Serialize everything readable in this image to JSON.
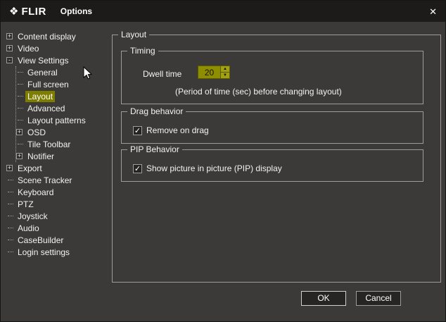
{
  "titlebar": {
    "brand": "FLIR",
    "title": "Options"
  },
  "icons": {
    "logo": "❖",
    "close": "✕",
    "up_arrow": "▲",
    "down_arrow": "▼",
    "check": "✓"
  },
  "tree": {
    "items": [
      {
        "label": "Content display",
        "glyph": "+"
      },
      {
        "label": "Video",
        "glyph": "+"
      },
      {
        "label": "View Settings",
        "glyph": "-"
      },
      {
        "label": "General"
      },
      {
        "label": "Full screen"
      },
      {
        "label": "Layout",
        "selected": true
      },
      {
        "label": "Advanced"
      },
      {
        "label": "Layout patterns"
      },
      {
        "label": "OSD",
        "glyph": "+"
      },
      {
        "label": "Tile Toolbar"
      },
      {
        "label": "Notifier",
        "glyph": "+"
      },
      {
        "label": "Export",
        "glyph": "+"
      },
      {
        "label": "Scene Tracker"
      },
      {
        "label": "Keyboard"
      },
      {
        "label": "PTZ"
      },
      {
        "label": "Joystick"
      },
      {
        "label": "Audio"
      },
      {
        "label": "CaseBuilder"
      },
      {
        "label": "Login settings"
      }
    ]
  },
  "panel": {
    "title": "Layout",
    "timing": {
      "title": "Timing",
      "dwell_label": "Dwell time",
      "dwell_value": "20",
      "hint": "(Period of time (sec) before changing layout)"
    },
    "drag": {
      "title": "Drag behavior",
      "option": "Remove on drag",
      "checked": true
    },
    "pip": {
      "title": "PIP Behavior",
      "option": "Show picture in picture (PIP) display",
      "checked": true
    }
  },
  "buttons": {
    "ok": "OK",
    "cancel": "Cancel"
  },
  "colors": {
    "highlight": "#7d7d00",
    "background": "#3b3a38",
    "titlebar": "#1d1b19"
  }
}
